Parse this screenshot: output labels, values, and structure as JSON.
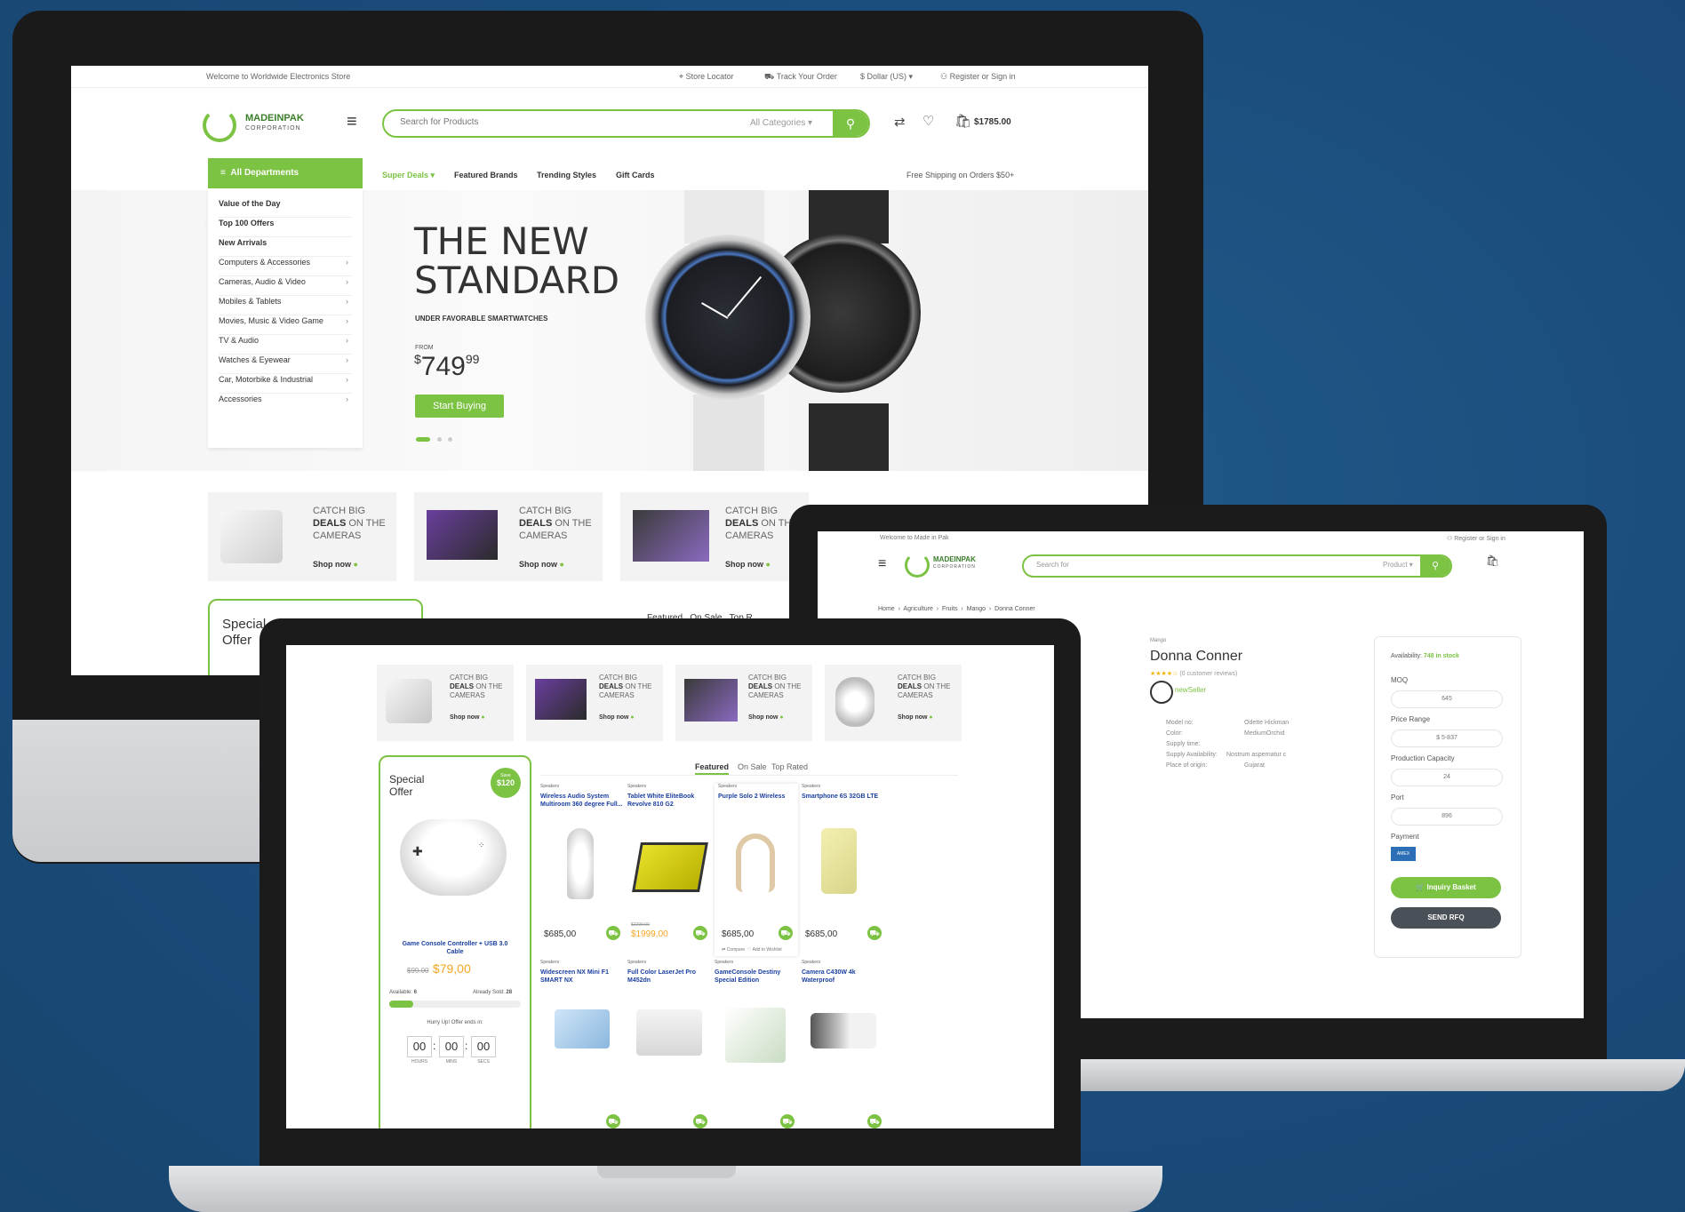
{
  "desktop": {
    "topbar": {
      "welcome": "Welcome to Worldwide Electronics Store",
      "store_locator": "Store Locator",
      "track_order": "Track Your Order",
      "currency": "Dollar (US)",
      "register": "Register",
      "or": "or",
      "sign_in": "Sign in"
    },
    "logo": {
      "name": "MADEINPAK",
      "sub": "CORPORATION"
    },
    "search": {
      "placeholder": "Search for Products",
      "category": "All Categories"
    },
    "cart_total": "$1785.00",
    "departments_label": "All Departments",
    "departments": [
      "Value of the Day",
      "Top 100 Offers",
      "New Arrivals",
      "Computers & Accessories",
      "Cameras, Audio & Video",
      "Mobiles & Tablets",
      "Movies, Music & Video Game",
      "TV & Audio",
      "Watches & Eyewear",
      "Car, Motorbike & Industrial",
      "Accessories"
    ],
    "nav": [
      "Super Deals",
      "Featured Brands",
      "Trending Styles",
      "Gift Cards"
    ],
    "free_shipping": "Free Shipping on Orders $50+",
    "hero": {
      "title_line1": "THE NEW",
      "title_line2": "STANDARD",
      "subtitle": "UNDER FAVORABLE SMARTWATCHES",
      "from": "FROM",
      "currency": "$",
      "price_main": "749",
      "price_cents": "99",
      "button": "Start Buying"
    },
    "deals": [
      {
        "line1": "CATCH BIG",
        "line2": "DEALS",
        "line2b": "ON THE",
        "line3": "CAMERAS",
        "cta": "Shop now"
      },
      {
        "line1": "CATCH BIG",
        "line2": "DEALS",
        "line2b": "ON THE",
        "line3": "CAMERAS",
        "cta": "Shop now"
      },
      {
        "line1": "CATCH BIG",
        "line2": "DEALS",
        "line2b": "ON THE",
        "line3": "CAMERAS",
        "cta": "Shop now"
      }
    ],
    "special_line1": "Special",
    "special_line2": "Offer",
    "tabs_partial": "Featured   On Sale   Top R"
  },
  "product_page": {
    "welcome": "Welcome to Made in Pak",
    "register": "Register",
    "or": "or",
    "sign_in": "Sign in",
    "logo": {
      "name": "MADEINPAK",
      "sub": "CORPORATION"
    },
    "search": {
      "placeholder": "Search for",
      "category": "Product"
    },
    "breadcrumb": [
      "Home",
      "Agriculture",
      "Fruits",
      "Mango",
      "Donna Conner"
    ],
    "category": "Mango",
    "title": "Donna Conner",
    "stars": "★★★★☆",
    "reviews": "(0 customer reviews)",
    "seller": "newSeller",
    "specs": [
      {
        "label": "Model no:",
        "value": "Odette Hickman"
      },
      {
        "label": "Color:",
        "value": "MediumOrchid"
      },
      {
        "label": "Supply time:",
        "value": ""
      },
      {
        "label": "Supply Availability:",
        "value": "Nostrum aspernatur c"
      },
      {
        "label": "Place of origin:",
        "value": "Gujarat"
      }
    ],
    "availability_label": "Availability:",
    "availability_value": "748 in stock",
    "moq_label": "MOQ",
    "moq_value": "645",
    "price_range_label": "Price Range",
    "price_range_value": "$ 5-837",
    "capacity_label": "Production Capacity",
    "capacity_value": "24",
    "port_label": "Port",
    "port_value": "896",
    "payment_label": "Payment",
    "payment_value": "AMEX",
    "inquiry_button": "Inquiry Basket",
    "rfq_button": "SEND RFQ"
  },
  "mobile_home": {
    "deals": [
      {
        "line1": "CATCH BIG",
        "line2": "DEALS",
        "line2b": "ON THE",
        "line3": "CAMERAS",
        "cta": "Shop now"
      },
      {
        "line1": "CATCH BIG",
        "line2": "DEALS",
        "line2b": "ON THE",
        "line3": "CAMERAS",
        "cta": "Shop now"
      },
      {
        "line1": "CATCH BIG",
        "line2": "DEALS",
        "line2b": "ON THE",
        "line3": "CAMERAS",
        "cta": "Shop now"
      },
      {
        "line1": "CATCH BIG",
        "line2": "DEALS",
        "line2b": "ON THE",
        "line3": "CAMERAS",
        "cta": "Shop now"
      }
    ],
    "special": {
      "line1": "Special",
      "line2": "Offer",
      "badge_save": "Save",
      "badge_amount": "$120",
      "product_name": "Game Console Controller + USB 3.0 Cable",
      "old_price": "$99.00",
      "new_price": "$79,00",
      "available_label": "Available:",
      "available_value": "6",
      "sold_label": "Already Sold:",
      "sold_value": "28",
      "progress": 0.18,
      "hurry": "Hurry Up! Offer ends in:",
      "countdown": [
        "00",
        "00",
        "00"
      ],
      "countdown_labels": [
        "HOURS",
        "MINS",
        "SECS"
      ]
    },
    "tabs": [
      "Featured",
      "On Sale",
      "Top Rated"
    ],
    "products": [
      {
        "cat": "Speakers",
        "name": "Wireless Audio System Multiroom 360 degree Full...",
        "old": "",
        "price": "$685,00",
        "sale": false
      },
      {
        "cat": "Speakers",
        "name": "Tablet White EliteBook Revolve 810 G2",
        "old": "$2299.00",
        "price": "$1999,00",
        "sale": true
      },
      {
        "cat": "Speakers",
        "name": "Purple Solo 2 Wireless",
        "old": "",
        "price": "$685,00",
        "sale": false
      },
      {
        "cat": "Speakers",
        "name": "Smartphone 6S 32GB LTE",
        "old": "",
        "price": "$685,00",
        "sale": false
      },
      {
        "cat": "Speakers",
        "name": "Widescreen NX Mini F1 SMART NX",
        "old": "",
        "price": "",
        "sale": false
      },
      {
        "cat": "Speakers",
        "name": "Full Color LaserJet Pro M452dn",
        "old": "",
        "price": "",
        "sale": false
      },
      {
        "cat": "Speakers",
        "name": "GameConsole Destiny Special Edition",
        "old": "",
        "price": "",
        "sale": false
      },
      {
        "cat": "Speakers",
        "name": "Camera C430W 4k Waterproof",
        "old": "",
        "price": "",
        "sale": false
      }
    ],
    "compare": "Compare",
    "wishlist": "Add to Wishlist"
  },
  "colors": {
    "accent": "#7cc243",
    "background": "#1a4c7a",
    "link": "#1a3fa0"
  }
}
